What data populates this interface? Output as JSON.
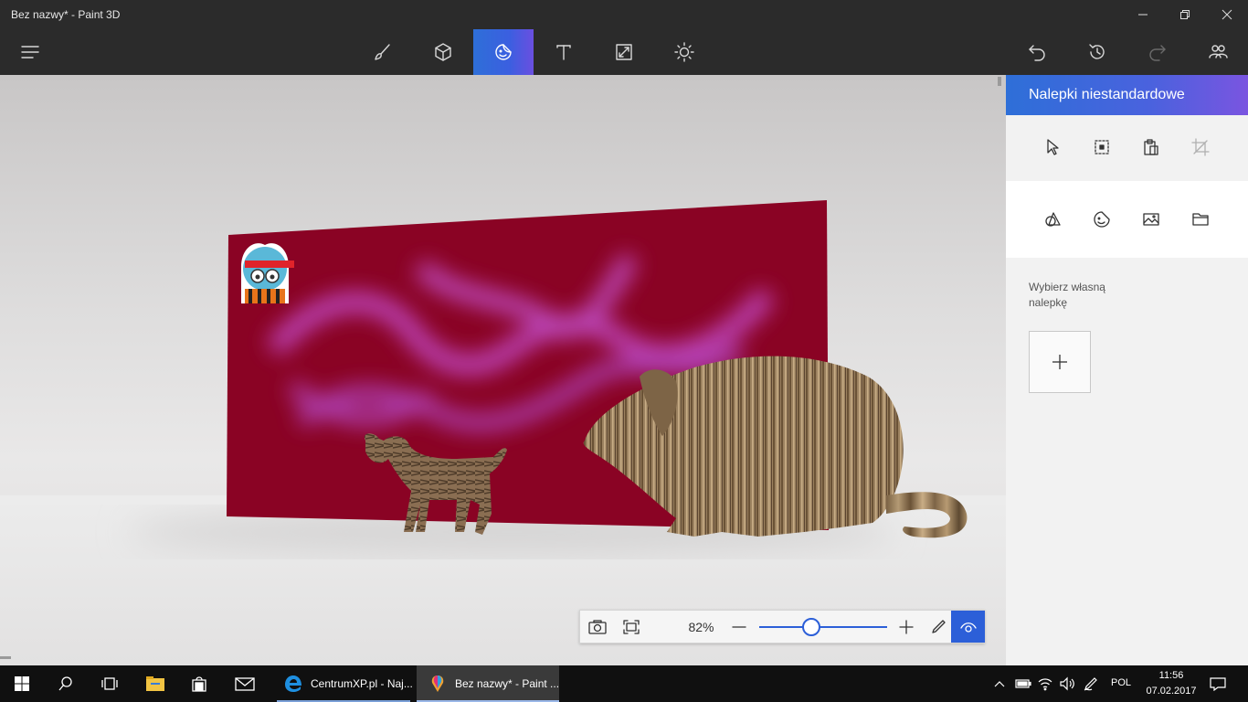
{
  "window": {
    "title": "Bez nazwy* - Paint 3D",
    "minimize_icon": "minimize-icon",
    "restore_icon": "restore-icon",
    "close_icon": "close-icon"
  },
  "toolbar": {
    "tools": [
      {
        "name": "menu",
        "icon": "hamburger-menu-icon"
      },
      {
        "name": "brushes",
        "icon": "brush-icon"
      },
      {
        "name": "3d-objects",
        "icon": "cube-icon"
      },
      {
        "name": "stickers",
        "icon": "sticker-icon",
        "active": true
      },
      {
        "name": "text",
        "icon": "text-icon"
      },
      {
        "name": "canvas",
        "icon": "resize-icon"
      },
      {
        "name": "effects",
        "icon": "sun-icon"
      },
      {
        "name": "undo",
        "icon": "undo-icon"
      },
      {
        "name": "history",
        "icon": "history-icon"
      },
      {
        "name": "redo",
        "icon": "redo-icon",
        "disabled": true
      },
      {
        "name": "community",
        "icon": "community-icon"
      }
    ],
    "accent": "#3b5fe0"
  },
  "panel": {
    "title": "Nalepki niestandardowe",
    "edit_tools": [
      "cursor-icon",
      "select-icon",
      "paste-icon",
      "crop-icon"
    ],
    "sticker_sources": [
      "shapes-sticker-icon",
      "emoji-sticker-icon",
      "image-sticker-icon",
      "folder-icon"
    ],
    "choose_label": "Wybierz własną nalepkę",
    "add_icon": "plus-icon"
  },
  "zoom": {
    "percent_label": "82%",
    "value_percent": 82,
    "slider_fraction": 0.41
  },
  "taskbar": {
    "apps": [
      {
        "label": "CentrumXP.pl - Naj...",
        "icon": "edge-icon"
      },
      {
        "label": "Bez nazwy* - Paint ...",
        "icon": "paint3d-icon",
        "active": true
      }
    ],
    "language": "POL",
    "time": "11:56",
    "date": "07.02.2017"
  }
}
